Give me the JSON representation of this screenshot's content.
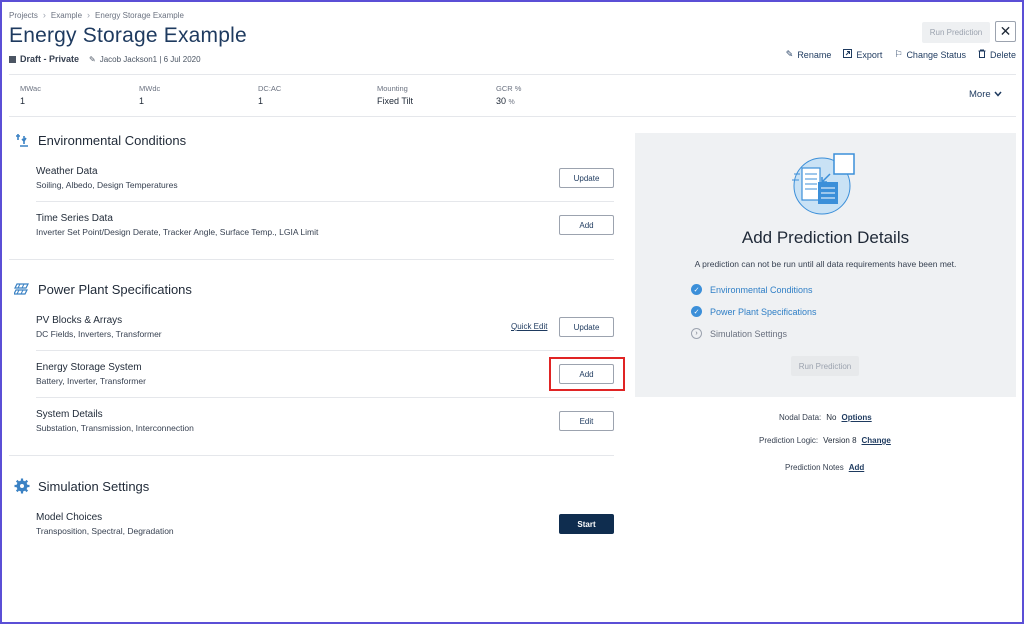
{
  "breadcrumb": [
    "Projects",
    "Example",
    "Energy Storage Example"
  ],
  "page": {
    "title": "Energy Storage Example",
    "status": "Draft - Private",
    "author": "Jacob Jackson1 | 6 Jul 2020"
  },
  "header_actions": {
    "run_prediction": "Run Prediction",
    "close": "✕",
    "rename": "Rename",
    "export": "Export",
    "change_status": "Change Status",
    "delete": "Delete"
  },
  "stats": [
    {
      "label": "MWac",
      "value": "1",
      "unit": ""
    },
    {
      "label": "MWdc",
      "value": "1",
      "unit": ""
    },
    {
      "label": "DC:AC",
      "value": "1",
      "unit": ""
    },
    {
      "label": "Mounting",
      "value": "Fixed Tilt",
      "unit": ""
    },
    {
      "label": "GCR %",
      "value": "30",
      "unit": "%"
    }
  ],
  "more_label": "More",
  "sections": {
    "environmental": {
      "title": "Environmental Conditions",
      "items": [
        {
          "title": "Weather Data",
          "subtitle": "Soiling, Albedo, Design Temperatures",
          "button": "Update"
        },
        {
          "title": "Time Series Data",
          "subtitle": "Inverter Set Point/Design Derate, Tracker Angle, Surface Temp., LGIA Limit",
          "button": "Add"
        }
      ]
    },
    "power_plant": {
      "title": "Power Plant Specifications",
      "items": [
        {
          "title": "PV Blocks & Arrays",
          "subtitle": "DC Fields, Inverters, Transformer",
          "button": "Update",
          "extra_link": "Quick Edit"
        },
        {
          "title": "Energy Storage System",
          "subtitle": "Battery, Inverter, Transformer",
          "button": "Add"
        },
        {
          "title": "System Details",
          "subtitle": "Substation, Transmission, Interconnection",
          "button": "Edit"
        }
      ]
    },
    "simulation": {
      "title": "Simulation Settings",
      "items": [
        {
          "title": "Model Choices",
          "subtitle": "Transposition, Spectral, Degradation",
          "button": "Start"
        }
      ]
    }
  },
  "panel": {
    "title": "Add Prediction Details",
    "description": "A prediction can not be run until all data requirements have been met.",
    "checklist": [
      {
        "label": "Environmental Conditions",
        "done": true
      },
      {
        "label": "Power Plant Specifications",
        "done": true
      },
      {
        "label": "Simulation Settings",
        "done": false
      }
    ],
    "run_button": "Run Prediction"
  },
  "side_info": {
    "nodal_label": "Nodal Data:",
    "nodal_value": "No",
    "nodal_link": "Options",
    "logic_label": "Prediction Logic:",
    "logic_value": "Version 8",
    "logic_link": "Change",
    "notes_label": "Prediction Notes",
    "notes_link": "Add"
  },
  "colors": {
    "accent": "#3b8fd9",
    "primary_dark": "#0f2d4f",
    "highlight": "#e02424",
    "frame": "#5b4fd6"
  }
}
